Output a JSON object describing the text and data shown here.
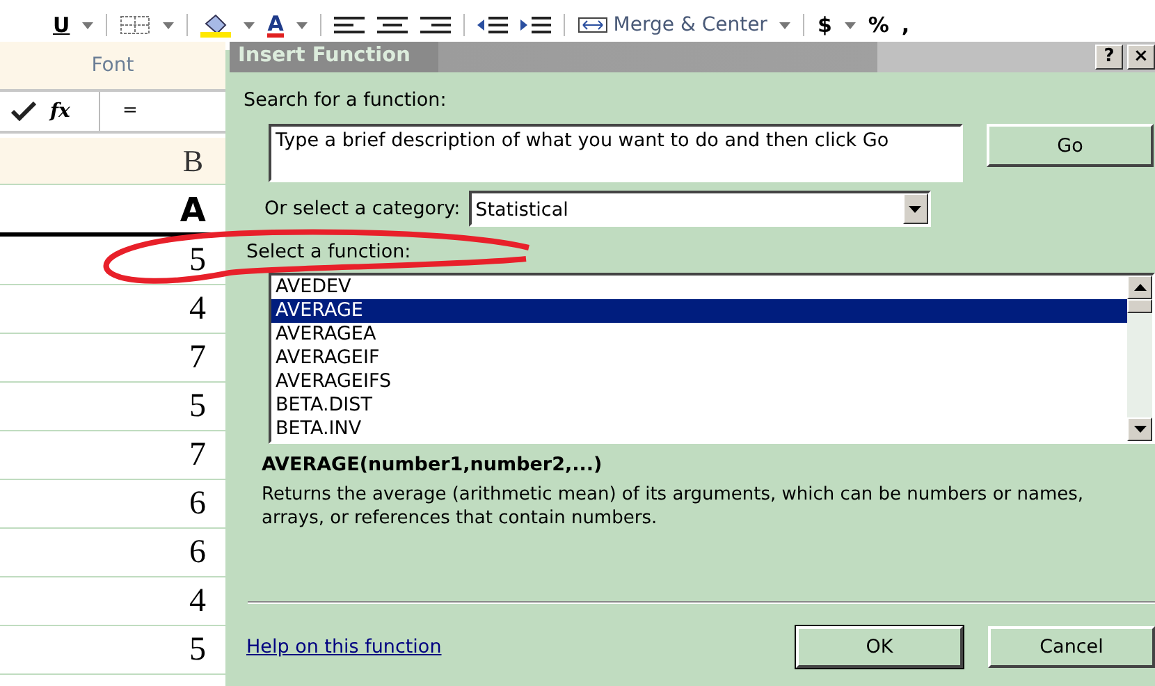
{
  "toolbar": {
    "items": [
      {
        "kind": "underline",
        "label": "U"
      },
      {
        "kind": "caret"
      },
      {
        "kind": "sep"
      },
      {
        "kind": "borders"
      },
      {
        "kind": "caret"
      },
      {
        "kind": "sep"
      },
      {
        "kind": "fill"
      },
      {
        "kind": "caret"
      },
      {
        "kind": "fontcolor",
        "label": "A"
      },
      {
        "kind": "caret"
      },
      {
        "kind": "sep"
      },
      {
        "kind": "align-left"
      },
      {
        "kind": "align-center"
      },
      {
        "kind": "align-right"
      },
      {
        "kind": "sep"
      },
      {
        "kind": "indent-less"
      },
      {
        "kind": "indent-more"
      },
      {
        "kind": "sep"
      },
      {
        "kind": "merge",
        "label": "Merge & Center"
      },
      {
        "kind": "caret"
      },
      {
        "kind": "sep"
      },
      {
        "kind": "text",
        "label": "$"
      },
      {
        "kind": "caret"
      },
      {
        "kind": "text",
        "label": "%"
      },
      {
        "kind": "text",
        "label": ","
      }
    ],
    "group_label": "Font"
  },
  "formula_bar": {
    "fx_label": "fx",
    "value": "="
  },
  "sheet": {
    "column_header": "B",
    "header_cell": "A",
    "values": [
      "5",
      "4",
      "7",
      "5",
      "7",
      "6",
      "6",
      "4",
      "5"
    ]
  },
  "dialog": {
    "title": "Insert Function",
    "title_buttons": [
      "?",
      "×"
    ],
    "search_label": "Search for a function:",
    "search_value": "Type a brief description of what you want to do and then click Go",
    "go_button": "Go",
    "category_label": "Or select a category:",
    "category_value": "Statistical",
    "function_label": "Select a function:",
    "functions": [
      {
        "name": "AVEDEV",
        "selected": false
      },
      {
        "name": "AVERAGE",
        "selected": true
      },
      {
        "name": "AVERAGEA",
        "selected": false
      },
      {
        "name": "AVERAGEIF",
        "selected": false
      },
      {
        "name": "AVERAGEIFS",
        "selected": false
      },
      {
        "name": "BETA.DIST",
        "selected": false
      },
      {
        "name": "BETA.INV",
        "selected": false
      }
    ],
    "signature": "AVERAGE(number1,number2,...)",
    "description": "Returns the average (arithmetic mean) of its arguments, which can be numbers or names, arrays, or references that contain numbers.",
    "help_link": "Help on this function",
    "buttons": [
      "OK",
      "Cancel"
    ]
  },
  "annotation": {
    "kind": "ellipse",
    "color": "#e8202a"
  }
}
